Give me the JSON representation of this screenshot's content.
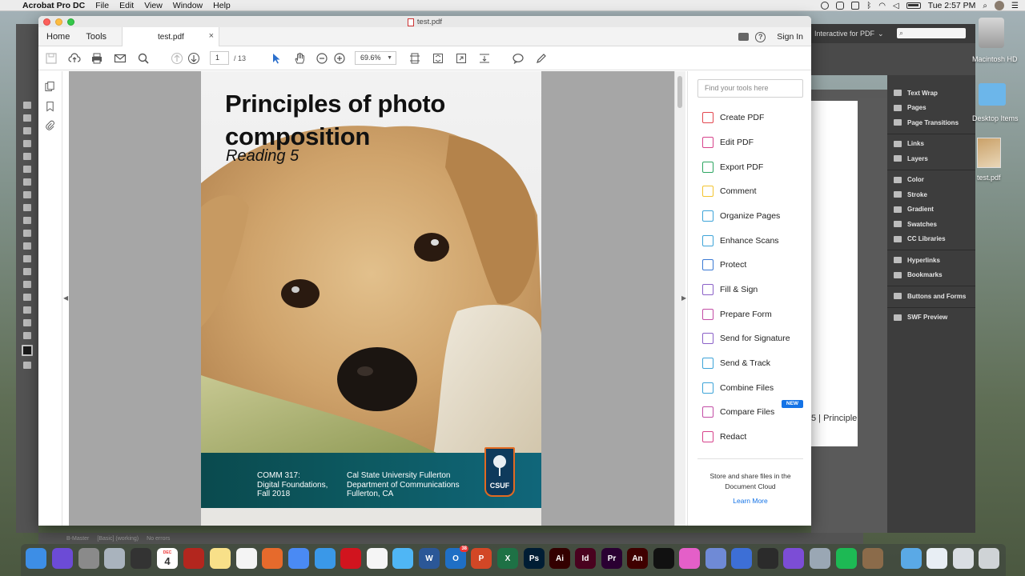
{
  "menubar": {
    "app_name": "Acrobat Pro DC",
    "items": [
      "File",
      "Edit",
      "View",
      "Window",
      "Help"
    ],
    "clock": "Tue 2:57 PM"
  },
  "background_app": {
    "workspace": "Interactive for PDF",
    "panel_groups": [
      [
        "Text Wrap",
        "Pages",
        "Page Transitions"
      ],
      [
        "Links",
        "Layers"
      ],
      [
        "Color",
        "Stroke",
        "Gradient",
        "Swatches",
        "CC Libraries"
      ],
      [
        "Hyperlinks",
        "Bookmarks"
      ],
      [
        "Buttons and Forms"
      ],
      [
        "SWF Preview"
      ]
    ],
    "page_text": "5 | Principle",
    "status": {
      "master": "B-Master",
      "style": "[Basic] (working)",
      "errors": "No errors"
    }
  },
  "desktop": {
    "hd_label": "Macintosh HD",
    "folder_label": "Desktop Items",
    "file_label": "test.pdf"
  },
  "window": {
    "title": "test.pdf",
    "tabs": {
      "home": "Home",
      "tools": "Tools",
      "document": "test.pdf",
      "close": "×"
    },
    "sign_in": "Sign In",
    "help_glyph": "?"
  },
  "toolbar": {
    "current_page": "1",
    "page_total": "/ 13",
    "zoom": "69.6%"
  },
  "document": {
    "title_line1": "Principles of photo",
    "title_line2": "composition",
    "subtitle": "Reading 5",
    "footer_col_a": [
      "COMM 317:",
      "Digital Foundations,",
      "Fall 2018"
    ],
    "footer_col_b": [
      "Cal State University Fullerton",
      "Department of Communications",
      "Fullerton, CA"
    ],
    "logo_text": "CSUF"
  },
  "tools_pane": {
    "search_placeholder": "Find your tools here",
    "items": [
      {
        "label": "Create PDF",
        "color": "#e34850"
      },
      {
        "label": "Edit PDF",
        "color": "#d7448c"
      },
      {
        "label": "Export PDF",
        "color": "#2da661"
      },
      {
        "label": "Comment",
        "color": "#f4c430"
      },
      {
        "label": "Organize Pages",
        "color": "#3ea4d8"
      },
      {
        "label": "Enhance Scans",
        "color": "#3ea4d8"
      },
      {
        "label": "Protect",
        "color": "#3a79d4"
      },
      {
        "label": "Fill & Sign",
        "color": "#8b61c8"
      },
      {
        "label": "Prepare Form",
        "color": "#c24da6"
      },
      {
        "label": "Send for Signature",
        "color": "#8b61c8"
      },
      {
        "label": "Send & Track",
        "color": "#3ea4d8"
      },
      {
        "label": "Combine Files",
        "color": "#3ea4d8"
      },
      {
        "label": "Compare Files",
        "color": "#c24da6"
      },
      {
        "label": "Redact",
        "color": "#d7448c"
      }
    ],
    "new_badge": "NEW",
    "store_text": "Store and share files in the Document Cloud",
    "learn_more": "Learn More"
  },
  "dock": {
    "calendar_month": "DEC",
    "calendar_day": "4",
    "outlook_badge": "38",
    "apps": [
      "Finder",
      "Siri",
      "System Preferences",
      "Launchpad",
      "Photo Booth",
      "Calendar",
      "Acrobat Reader",
      "Notes",
      "Reminders",
      "Firefox",
      "Chrome",
      "Safari",
      "Opera",
      "Photos",
      "Messages",
      "Word",
      "Outlook",
      "PowerPoint",
      "Excel",
      "Photoshop",
      "Illustrator",
      "InDesign",
      "Premiere",
      "Animate",
      "Acrobat",
      "iTunes",
      "Dictionary",
      "Keynote",
      "QuickTime",
      "Vectorize",
      "Image Capture",
      "Spotify",
      "Archive",
      "Downloads Folder",
      "Preview",
      "Mail Stack",
      "Trash"
    ],
    "labels": {
      "word": "W",
      "outlook": "O",
      "powerpoint": "P",
      "excel": "X",
      "photoshop": "Ps",
      "illustrator": "Ai",
      "indesign": "Id",
      "premiere": "Pr",
      "animate": "An"
    }
  }
}
